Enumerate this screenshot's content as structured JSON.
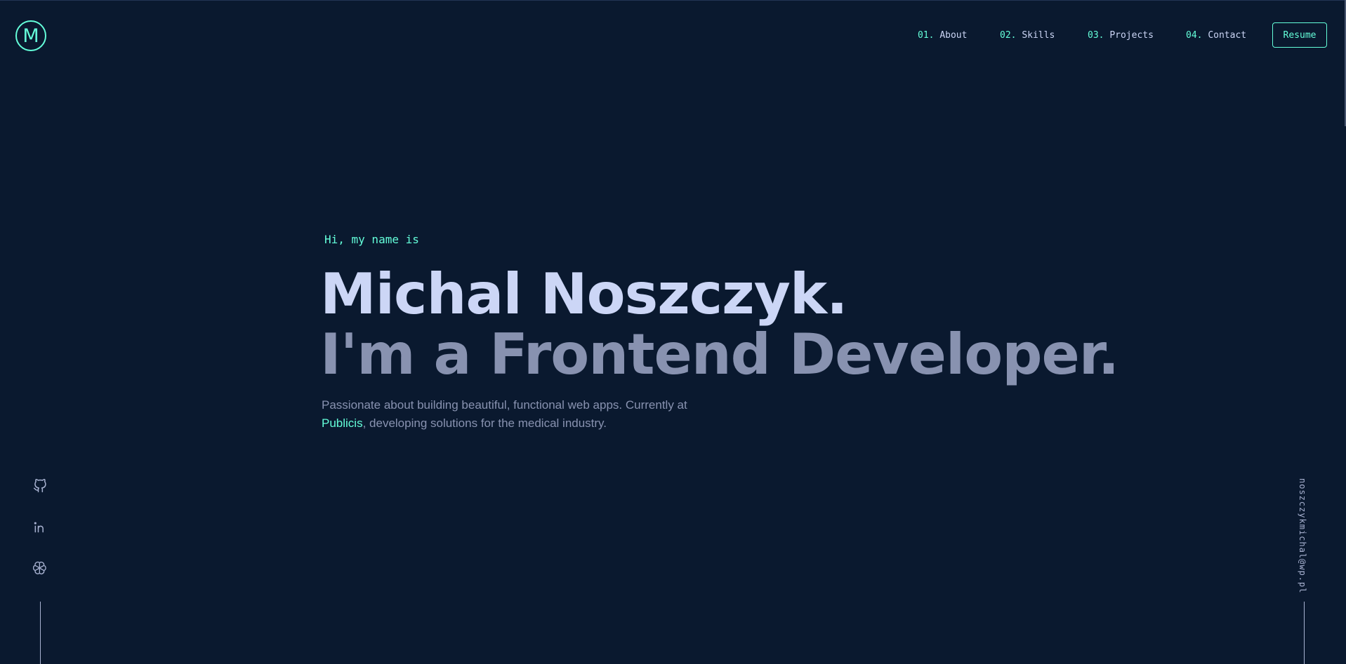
{
  "logo": {
    "letter": "M"
  },
  "nav": {
    "items": [
      {
        "num": "01.",
        "label": "About"
      },
      {
        "num": "02.",
        "label": "Skills"
      },
      {
        "num": "03.",
        "label": "Projects"
      },
      {
        "num": "04.",
        "label": "Contact"
      }
    ],
    "resume_label": "Resume"
  },
  "hero": {
    "intro": "Hi, my name is",
    "name": "Michal Noszczyk.",
    "role": "I'm a Frontend Developer.",
    "description_start": "Passionate about building beautiful, functional web apps. Currently at",
    "company": "Publicis",
    "description_end": ", developing solutions for the medical industry."
  },
  "social": {
    "items": [
      {
        "icon": "github-icon"
      },
      {
        "icon": "linkedin-icon"
      },
      {
        "icon": "openai-icon"
      }
    ]
  },
  "email": "noszczykmichal@wp.pl",
  "colors": {
    "background": "#0a192f",
    "accent": "#64ffda",
    "heading": "#ccd6f6",
    "muted": "#8892b0"
  }
}
